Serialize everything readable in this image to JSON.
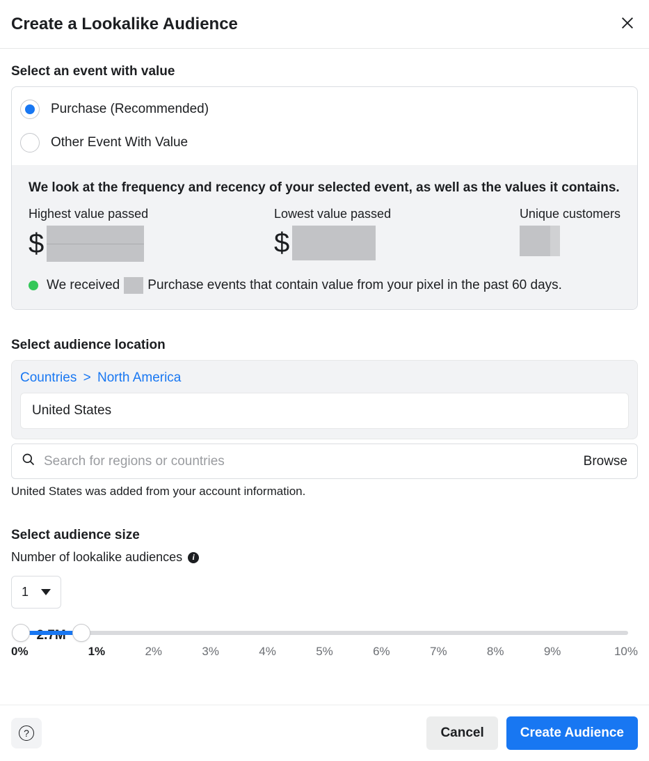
{
  "header": {
    "title": "Create a Lookalike Audience"
  },
  "event": {
    "heading": "Select an event with value",
    "options": [
      {
        "label": "Purchase (Recommended)",
        "selected": true
      },
      {
        "label": "Other Event With Value",
        "selected": false
      }
    ],
    "info": {
      "headline": "We look at the frequency and recency of your selected event, as well as the values it contains.",
      "highest_label": "Highest value passed",
      "lowest_label": "Lowest value passed",
      "unique_label": "Unique customers",
      "currency_symbol": "$",
      "received_prefix": "We received",
      "received_suffix": "Purchase events that contain value from your pixel in the past 60 days."
    }
  },
  "location": {
    "heading": "Select audience location",
    "breadcrumb": {
      "root": "Countries",
      "sep": ">",
      "leaf": "North America"
    },
    "selected": "United States",
    "search_placeholder": "Search for regions or countries",
    "browse_label": "Browse",
    "note": "United States was added from your account information."
  },
  "size": {
    "heading": "Select audience size",
    "num_label": "Number of lookalike audiences",
    "select_value": "1",
    "slider": {
      "value_label": "2.7M",
      "start_pct": 0,
      "end_pct": 10,
      "ticks": [
        "0%",
        "1%",
        "2%",
        "3%",
        "4%",
        "5%",
        "6%",
        "7%",
        "8%",
        "9%",
        "10%"
      ]
    }
  },
  "footer": {
    "cancel": "Cancel",
    "create": "Create Audience"
  }
}
